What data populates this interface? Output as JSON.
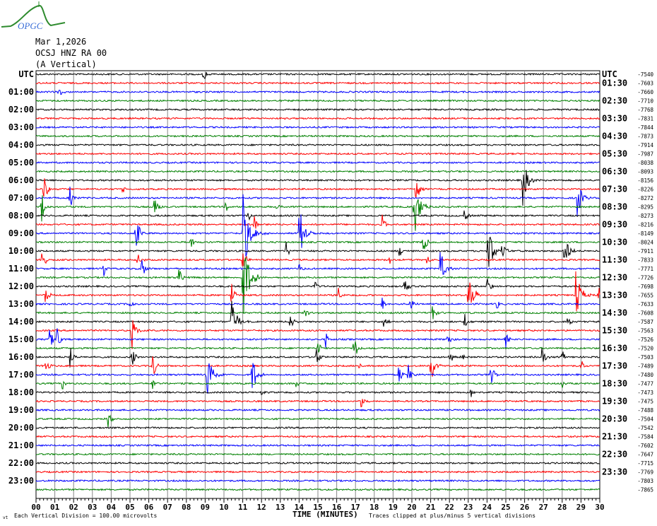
{
  "logo": {
    "text": "OPGC",
    "colors": {
      "curve": "#2e8b2e",
      "text": "#3a6fd8"
    }
  },
  "header": {
    "date": "Mar 1,2026",
    "station": "OCSJ HNZ RA 00",
    "component": "(A Vertical)"
  },
  "footer": {
    "left_mark": "vt",
    "division": "Each Vertical Division =  100.00 microvolts",
    "xlabel": "TIME (MINUTES)",
    "clip_note": "Traces clipped at plus/minus 5 vertical divisions"
  },
  "chart_data": {
    "type": "line",
    "subtype": "helicorder",
    "xlabel": "TIME (MINUTES)",
    "xlim": [
      0,
      30
    ],
    "x_ticks": [
      "00",
      "01",
      "02",
      "03",
      "04",
      "05",
      "06",
      "07",
      "08",
      "09",
      "10",
      "11",
      "12",
      "13",
      "14",
      "15",
      "16",
      "17",
      "18",
      "19",
      "20",
      "21",
      "22",
      "23",
      "24",
      "25",
      "26",
      "27",
      "28",
      "29",
      "30"
    ],
    "trace_colors": [
      "#000000",
      "#ff0000",
      "#0000ff",
      "#008000"
    ],
    "grid": true,
    "left_labels": [
      "UTC",
      "01:00",
      "02:00",
      "03:00",
      "04:00",
      "05:00",
      "06:00",
      "07:00",
      "08:00",
      "09:00",
      "10:00",
      "11:00",
      "12:00",
      "13:00",
      "14:00",
      "15:00",
      "16:00",
      "17:00",
      "18:00",
      "19:00",
      "20:00",
      "21:00",
      "22:00",
      "23:00"
    ],
    "right_labels": [
      "UTC",
      "01:30",
      "02:30",
      "03:30",
      "04:30",
      "05:30",
      "06:30",
      "07:30",
      "08:30",
      "09:30",
      "10:30",
      "11:30",
      "12:30",
      "13:30",
      "14:30",
      "15:30",
      "16:30",
      "17:30",
      "18:30",
      "19:30",
      "20:30",
      "21:30",
      "22:30",
      "23:30"
    ],
    "trace_offsets": [
      "-7540",
      "-7603",
      "-7660",
      "-7710",
      "-7768",
      "-7831",
      "-7844",
      "-7873",
      "-7914",
      "-7987",
      "-8038",
      "-8093",
      "-8156",
      "-8226",
      "-8272",
      "-8295",
      "-8273",
      "-8216",
      "-8149",
      "-8024",
      "-7911",
      "-7833",
      "-7771",
      "-7726",
      "-7698",
      "-7655",
      "-7633",
      "-7608",
      "-7587",
      "-7563",
      "-7526",
      "-7520",
      "-7503",
      "-7489",
      "-7480",
      "-7477",
      "-7473",
      "-7475",
      "-7488",
      "-7504",
      "-7542",
      "-7584",
      "-7602",
      "-7647",
      "-7715",
      "-7769",
      "-7803",
      "-7865"
    ],
    "amplitude_units": "vertical divisions",
    "clip_divisions": 5,
    "events": [
      [
        0,
        8.9,
        1.0
      ],
      [
        2,
        1.2,
        1.0
      ],
      [
        12,
        25.9,
        3.0
      ],
      [
        13,
        0.4,
        1.8
      ],
      [
        13,
        20.2,
        2.0
      ],
      [
        13,
        4.6,
        0.5
      ],
      [
        14,
        1.8,
        1.6
      ],
      [
        14,
        28.8,
        2.6
      ],
      [
        15,
        0.3,
        1.8
      ],
      [
        15,
        6.3,
        1.6
      ],
      [
        15,
        20.1,
        4.0
      ],
      [
        15,
        10.1,
        0.7
      ],
      [
        15,
        12.8,
        0.8
      ],
      [
        16,
        11.3,
        0.8
      ],
      [
        16,
        22.8,
        0.9
      ],
      [
        17,
        18.4,
        1.4
      ],
      [
        17,
        11.6,
        1.2
      ],
      [
        18,
        5.3,
        2.2
      ],
      [
        18,
        11.0,
        5.0
      ],
      [
        18,
        14.0,
        3.4
      ],
      [
        19,
        8.2,
        1.2
      ],
      [
        19,
        20.6,
        1.6
      ],
      [
        20,
        24.0,
        3.5
      ],
      [
        20,
        28.1,
        2.6
      ],
      [
        20,
        13.3,
        1.2
      ],
      [
        20,
        19.3,
        1.0
      ],
      [
        20,
        24.8,
        1.4
      ],
      [
        21,
        0.3,
        1.5
      ],
      [
        21,
        5.4,
        1.4
      ],
      [
        21,
        11.0,
        1.5
      ],
      [
        21,
        20.8,
        1.2
      ],
      [
        21,
        18.8,
        0.6
      ],
      [
        22,
        5.6,
        1.6
      ],
      [
        22,
        3.6,
        0.9
      ],
      [
        22,
        21.5,
        2.6
      ],
      [
        22,
        14.0,
        0.8
      ],
      [
        23,
        11.0,
        5.0
      ],
      [
        23,
        7.6,
        1.4
      ],
      [
        24,
        19.6,
        1.4
      ],
      [
        24,
        14.8,
        1.0
      ],
      [
        24,
        24.0,
        1.2
      ],
      [
        25,
        23.0,
        3.2
      ],
      [
        25,
        28.7,
        3.4
      ],
      [
        25,
        10.4,
        1.6
      ],
      [
        25,
        0.5,
        1.2
      ],
      [
        25,
        16.1,
        1.0
      ],
      [
        25,
        29.9,
        3.0
      ],
      [
        26,
        5.0,
        1.0
      ],
      [
        26,
        19.9,
        1.0
      ],
      [
        26,
        24.5,
        1.0
      ],
      [
        26,
        18.4,
        1.0
      ],
      [
        27,
        14.3,
        0.8
      ],
      [
        27,
        21.1,
        1.0
      ],
      [
        28,
        10.4,
        3.2
      ],
      [
        28,
        13.5,
        1.4
      ],
      [
        28,
        18.5,
        1.0
      ],
      [
        28,
        22.8,
        1.0
      ],
      [
        28,
        28.3,
        1.2
      ],
      [
        29,
        5.1,
        2.2
      ],
      [
        30,
        0.7,
        1.6
      ],
      [
        30,
        1.1,
        1.6
      ],
      [
        30,
        15.4,
        1.0
      ],
      [
        30,
        21.9,
        1.0
      ],
      [
        30,
        25.0,
        1.0
      ],
      [
        31,
        16.9,
        1.8
      ],
      [
        31,
        15.0,
        1.0
      ],
      [
        32,
        1.8,
        1.4
      ],
      [
        32,
        5.1,
        1.2
      ],
      [
        32,
        14.9,
        1.2
      ],
      [
        32,
        22.0,
        1.2
      ],
      [
        32,
        26.9,
        1.4
      ],
      [
        32,
        28.0,
        0.8
      ],
      [
        32,
        22.6,
        1.0
      ],
      [
        33,
        0.5,
        1.2
      ],
      [
        33,
        6.2,
        1.6
      ],
      [
        33,
        17.2,
        0.8
      ],
      [
        33,
        21.0,
        2.2
      ],
      [
        33,
        29.0,
        0.8
      ],
      [
        34,
        9.1,
        3.6
      ],
      [
        34,
        11.5,
        2.4
      ],
      [
        34,
        19.3,
        1.4
      ],
      [
        34,
        19.8,
        1.4
      ],
      [
        34,
        24.2,
        1.4
      ],
      [
        35,
        1.4,
        0.8
      ],
      [
        35,
        6.2,
        0.8
      ],
      [
        35,
        13.8,
        0.6
      ],
      [
        35,
        28.0,
        0.6
      ],
      [
        36,
        12.0,
        0.6
      ],
      [
        36,
        23.1,
        0.9
      ],
      [
        37,
        17.3,
        1.0
      ],
      [
        39,
        3.8,
        1.4
      ]
    ]
  }
}
